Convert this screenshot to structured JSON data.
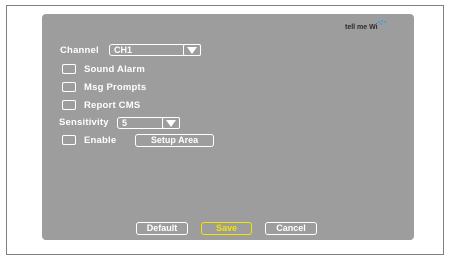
{
  "logo": {
    "text": "tell me Wi"
  },
  "channel": {
    "label": "Channel",
    "value": "CH1"
  },
  "options": [
    {
      "label": "Sound Alarm"
    },
    {
      "label": "Msg Prompts"
    },
    {
      "label": "Report CMS"
    }
  ],
  "sensitivity": {
    "label": "Sensitivity",
    "value": "5"
  },
  "enable": {
    "label": "Enable",
    "setup_button": "Setup Area"
  },
  "buttons": {
    "default": "Default",
    "save": "Save",
    "cancel": "Cancel"
  },
  "colors": {
    "panel": "#9d9d9d",
    "text": "#ffffff",
    "active": "#f2e400"
  }
}
